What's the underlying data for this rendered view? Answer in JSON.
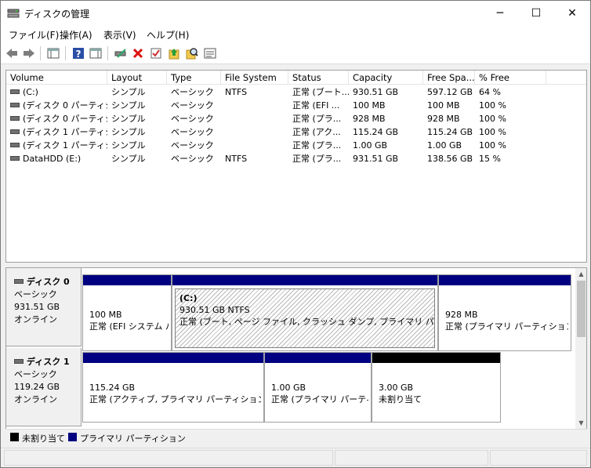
{
  "window": {
    "title": "ディスクの管理",
    "minimize": "─",
    "maximize": "☐",
    "close": "✕"
  },
  "menu": [
    "ファイル(F)",
    "操作(A)",
    "表示(V)",
    "ヘルプ(H)"
  ],
  "toolbar_icons": [
    "back-arrow-icon",
    "forward-arrow-icon",
    "console-tree-icon",
    "help-icon",
    "action-pane-icon",
    "connect-drive-icon",
    "delete-icon",
    "check-icon",
    "up-folder-icon",
    "search-icon",
    "properties-icon"
  ],
  "volume_table": {
    "columns": [
      "Volume",
      "Layout",
      "Type",
      "File System",
      "Status",
      "Capacity",
      "Free Spa...",
      "% Free"
    ],
    "rows": [
      [
        "(C:)",
        "シンプル",
        "ベーシック",
        "NTFS",
        "正常 (ブート...",
        "930.51 GB",
        "597.12 GB",
        "64 %"
      ],
      [
        "(ディスク 0 パーティシ...",
        "シンプル",
        "ベーシック",
        "",
        "正常 (EFI ...",
        "100 MB",
        "100 MB",
        "100 %"
      ],
      [
        "(ディスク 0 パーティシ...",
        "シンプル",
        "ベーシック",
        "",
        "正常 (プラ...",
        "928 MB",
        "928 MB",
        "100 %"
      ],
      [
        "(ディスク 1 パーティシ...",
        "シンプル",
        "ベーシック",
        "",
        "正常 (アク...",
        "115.24 GB",
        "115.24 GB",
        "100 %"
      ],
      [
        "(ディスク 1 パーティシ...",
        "シンプル",
        "ベーシック",
        "",
        "正常 (プラ...",
        "1.00 GB",
        "1.00 GB",
        "100 %"
      ],
      [
        "DataHDD (E:)",
        "シンプル",
        "ベーシック",
        "NTFS",
        "正常 (プラ...",
        "931.51 GB",
        "138.56 GB",
        "15 %"
      ]
    ]
  },
  "disks": [
    {
      "name": "ディスク 0",
      "type": "ベーシック",
      "size": "931.51 GB",
      "state": "オンライン",
      "partitions": [
        {
          "label": "",
          "size": "100 MB",
          "status": "正常 (EFI システム パ",
          "kind": "primary"
        },
        {
          "label": "(C:)",
          "size": "930.51 GB NTFS",
          "status": "正常 (ブート, ページ ファイル, クラッシュ ダンプ, プライマリ パーティション)",
          "kind": "primary",
          "selected": true
        },
        {
          "label": "",
          "size": "928 MB",
          "status": "正常 (プライマリ パーティション)",
          "kind": "primary"
        }
      ]
    },
    {
      "name": "ディスク 1",
      "type": "ベーシック",
      "size": "119.24 GB",
      "state": "オンライン",
      "partitions": [
        {
          "label": "",
          "size": "115.24 GB",
          "status": "正常 (アクティブ, プライマリ パーティション)",
          "kind": "primary"
        },
        {
          "label": "",
          "size": "1.00 GB",
          "status": "正常 (プライマリ パーティシ",
          "kind": "primary"
        },
        {
          "label": "",
          "size": "3.00 GB",
          "status": "未割り当て",
          "kind": "unallocated"
        }
      ]
    }
  ],
  "legend": [
    {
      "label": "未割り当て",
      "color": "#000000"
    },
    {
      "label": "プライマリ パーティション",
      "color": "#000080"
    }
  ],
  "colors": {
    "primary": "#000080",
    "unallocated": "#000000"
  }
}
